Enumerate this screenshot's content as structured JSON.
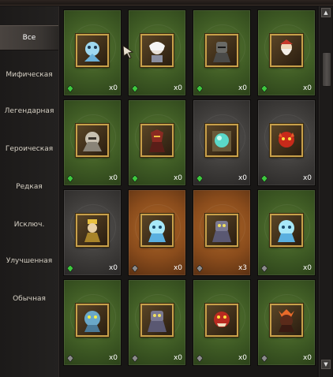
{
  "categories": [
    {
      "label": "Все",
      "active": true
    },
    {
      "label": "Мифическая",
      "active": false
    },
    {
      "label": "Легендарная",
      "active": false
    },
    {
      "label": "Героическая",
      "active": false
    },
    {
      "label": "Редкая",
      "active": false
    },
    {
      "label": "Исключ.",
      "active": false
    },
    {
      "label": "Улучшенная",
      "active": false
    },
    {
      "label": "Обычная",
      "active": false
    }
  ],
  "cards": [
    {
      "count": "x0",
      "bg": "green",
      "gem": "green",
      "icon": "ice-golem-icon"
    },
    {
      "count": "x0",
      "bg": "green",
      "gem": "green",
      "icon": "white-haired-hero-icon"
    },
    {
      "count": "x0",
      "bg": "green",
      "gem": "green",
      "icon": "armored-knight-icon"
    },
    {
      "count": "x0",
      "bg": "green",
      "gem": "green",
      "icon": "bearded-sage-icon"
    },
    {
      "count": "x0",
      "bg": "green",
      "gem": "green",
      "icon": "stone-colossus-icon"
    },
    {
      "count": "x0",
      "bg": "green",
      "gem": "green",
      "icon": "red-demon-knight-icon"
    },
    {
      "count": "x0",
      "bg": "gray",
      "gem": "green",
      "icon": "crystal-orb-icon"
    },
    {
      "count": "x0",
      "bg": "gray",
      "gem": "green",
      "icon": "fire-imp-icon"
    },
    {
      "count": "x0",
      "bg": "gray",
      "gem": "green",
      "icon": "golden-king-icon"
    },
    {
      "count": "x0",
      "bg": "orange",
      "gem": "gray",
      "icon": "frost-beast-icon"
    },
    {
      "count": "x3",
      "bg": "orange",
      "gem": "gray",
      "icon": "rock-golem-icon"
    },
    {
      "count": "x0",
      "bg": "green",
      "gem": "gray",
      "icon": "frost-beast-icon"
    },
    {
      "count": "x0",
      "bg": "green",
      "gem": "gray",
      "icon": "blue-troll-icon"
    },
    {
      "count": "x0",
      "bg": "green",
      "gem": "gray",
      "icon": "rock-golem-icon"
    },
    {
      "count": "x0",
      "bg": "green",
      "gem": "gray",
      "icon": "red-ogre-icon"
    },
    {
      "count": "x0",
      "bg": "green",
      "gem": "gray",
      "icon": "fire-demon-icon"
    }
  ],
  "colors": {
    "frame_gold": "#c8a04a",
    "gem_green": "#3ec83e",
    "gem_gray": "#8a8a8a"
  }
}
